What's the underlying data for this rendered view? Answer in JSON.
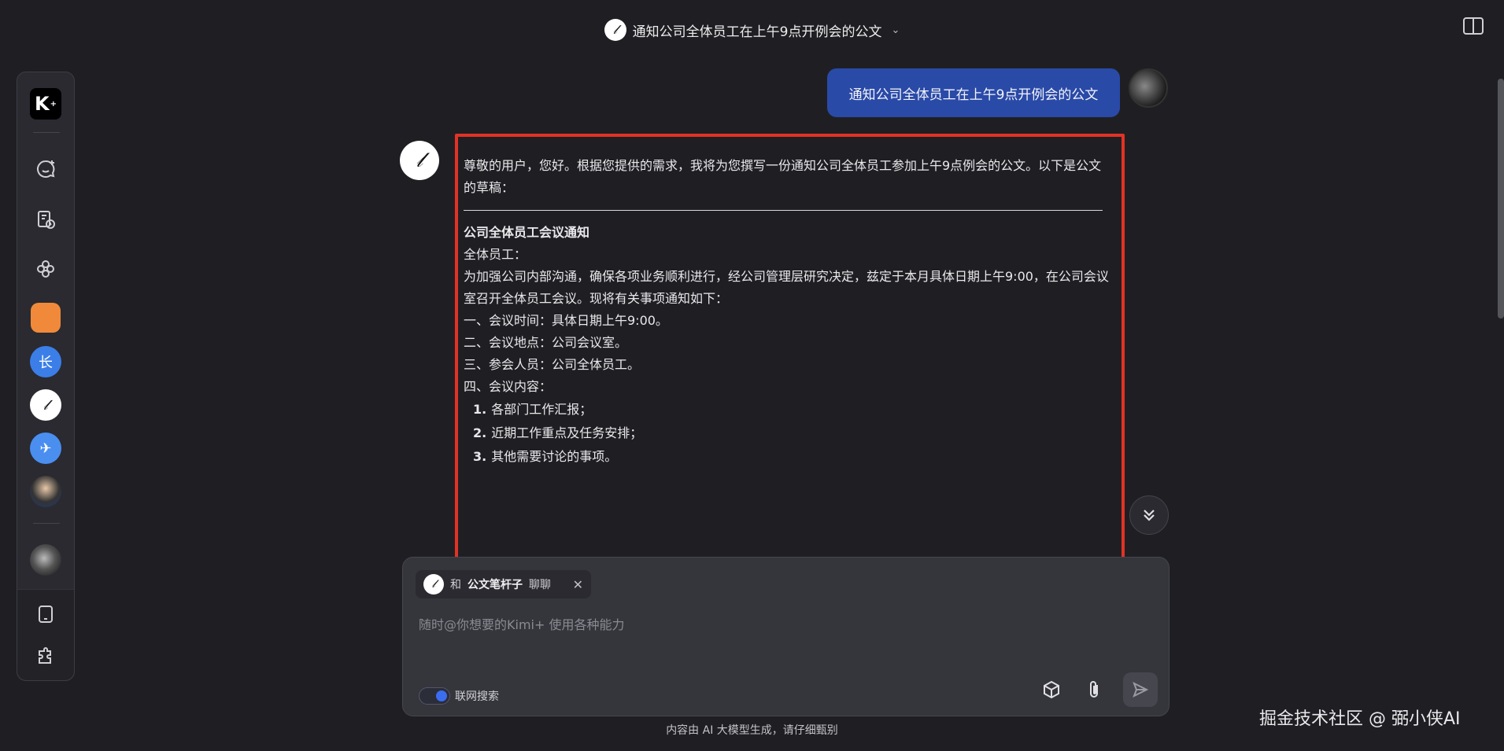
{
  "header": {
    "conversation_title": "通知公司全体员工在上午9点开例会的公文",
    "caret": "⌄"
  },
  "sidebar": {
    "logo": "K",
    "logo_sup": "+",
    "icons": [
      "new-chat-icon",
      "history-icon",
      "explore-icon",
      "mobile-icon",
      "plugin-icon"
    ],
    "avatars": [
      {
        "name": "avatar-orange",
        "color": "#f08a3a",
        "glyph": "▦"
      },
      {
        "name": "avatar-long",
        "color": "#3b7ee8",
        "glyph": "长"
      },
      {
        "name": "avatar-pen",
        "color": "#ffffff",
        "glyph": "𝓁"
      },
      {
        "name": "avatar-travel",
        "color": "#4a8ef0",
        "glyph": "✈"
      },
      {
        "name": "avatar-person",
        "color": "#1d3a7a",
        "glyph": "●"
      },
      {
        "name": "avatar-user",
        "color": "#555555",
        "glyph": "◉"
      }
    ]
  },
  "user_message": "通知公司全体员工在上午9点开例会的公文",
  "bot_glyph": "𝓁",
  "reply": {
    "intro": "尊敬的用户，您好。根据您提供的需求，我将为您撰写一份通知公司全体员工参加上午9点例会的公文。以下是公文的草稿：",
    "heading": "公司全体员工会议通知",
    "salutation": "全体员工：",
    "body": "为加强公司内部沟通，确保各项业务顺利进行，经公司管理层研究决定，兹定于本月具体日期上午9:00，在公司会议室召开全体员工会议。现将有关事项通知如下：",
    "item1": "一、会议时间：具体日期上午9:00。",
    "item2": "二、会议地点：公司会议室。",
    "item3": "三、参会人员：公司全体员工。",
    "item4": "四、会议内容：",
    "list": [
      {
        "num": "1.",
        "text": "各部门工作汇报；"
      },
      {
        "num": "2.",
        "text": "近期工作重点及任务安排；"
      },
      {
        "num": "3.",
        "text": "其他需要讨论的事项。"
      }
    ]
  },
  "composer": {
    "chip_prefix": "和",
    "chip_name": "公文笔杆子",
    "chip_suffix": "聊聊",
    "chip_close": "✕",
    "placeholder": "随时@你想要的Kimi+ 使用各种能力",
    "web_search_label": "联网搜索",
    "web_search_on": true
  },
  "footer_note": "内容由 AI 大模型生成，请仔细甄别",
  "watermark": "掘金技术社区 @ 弼小侠AI",
  "colors": {
    "accent": "#2a4aa8",
    "highlight_border": "#e23226",
    "toggle": "#3a6df0"
  }
}
